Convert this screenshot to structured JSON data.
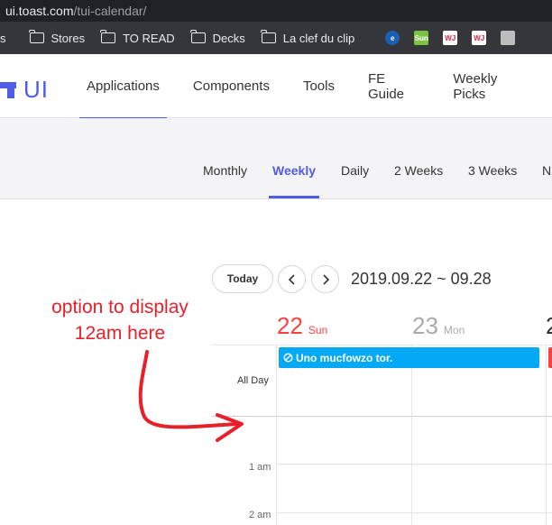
{
  "browser": {
    "url_host": "ui.toast.com",
    "url_path": "/tui-calendar/",
    "bookmarks": [
      "s",
      "Stores",
      "TO READ",
      "Decks",
      "La clef du clip"
    ],
    "favicons": [
      {
        "name": "e-icon",
        "label": "e",
        "color": "#ffffff",
        "bg": "#1a5fb4"
      },
      {
        "name": "sun-icon",
        "label": "Sun",
        "color": "#ffffff",
        "bg": "#7cc242"
      },
      {
        "name": "wsj-icon",
        "label": "WJ",
        "color": "#d7263d",
        "bg": "#ffffff"
      },
      {
        "name": "wsj2-icon",
        "label": "WJ",
        "color": "#d7263d",
        "bg": "#ffffff"
      },
      {
        "name": "page-icon",
        "label": "",
        "color": "#ffffff",
        "bg": "#bdbdbd"
      }
    ]
  },
  "site": {
    "logo_text": "UI",
    "nav": [
      "Applications",
      "Components",
      "Tools",
      "FE Guide",
      "Weekly Picks"
    ],
    "active_nav": "Applications"
  },
  "view_tabs": [
    "Monthly",
    "Weekly",
    "Daily",
    "2 Weeks",
    "3 Weeks",
    "N"
  ],
  "active_view": "Weekly",
  "calendar": {
    "today_label": "Today",
    "range_label": "2019.09.22 ~ 09.28",
    "days": [
      {
        "num": "22",
        "name": "Sun"
      },
      {
        "num": "23",
        "name": "Mon"
      },
      {
        "num": "2",
        "name": ""
      }
    ],
    "allday_label": "All Day",
    "time_labels": [
      "1 am",
      "2 am"
    ],
    "event_title": "Uno mucfowzo tor."
  },
  "annotation": {
    "line1": "option to display",
    "line2": "12am here"
  },
  "colors": {
    "brand": "#515ce6",
    "sunday": "#ff4040",
    "event": "#03a9f4",
    "annotation": "#e8202a"
  }
}
